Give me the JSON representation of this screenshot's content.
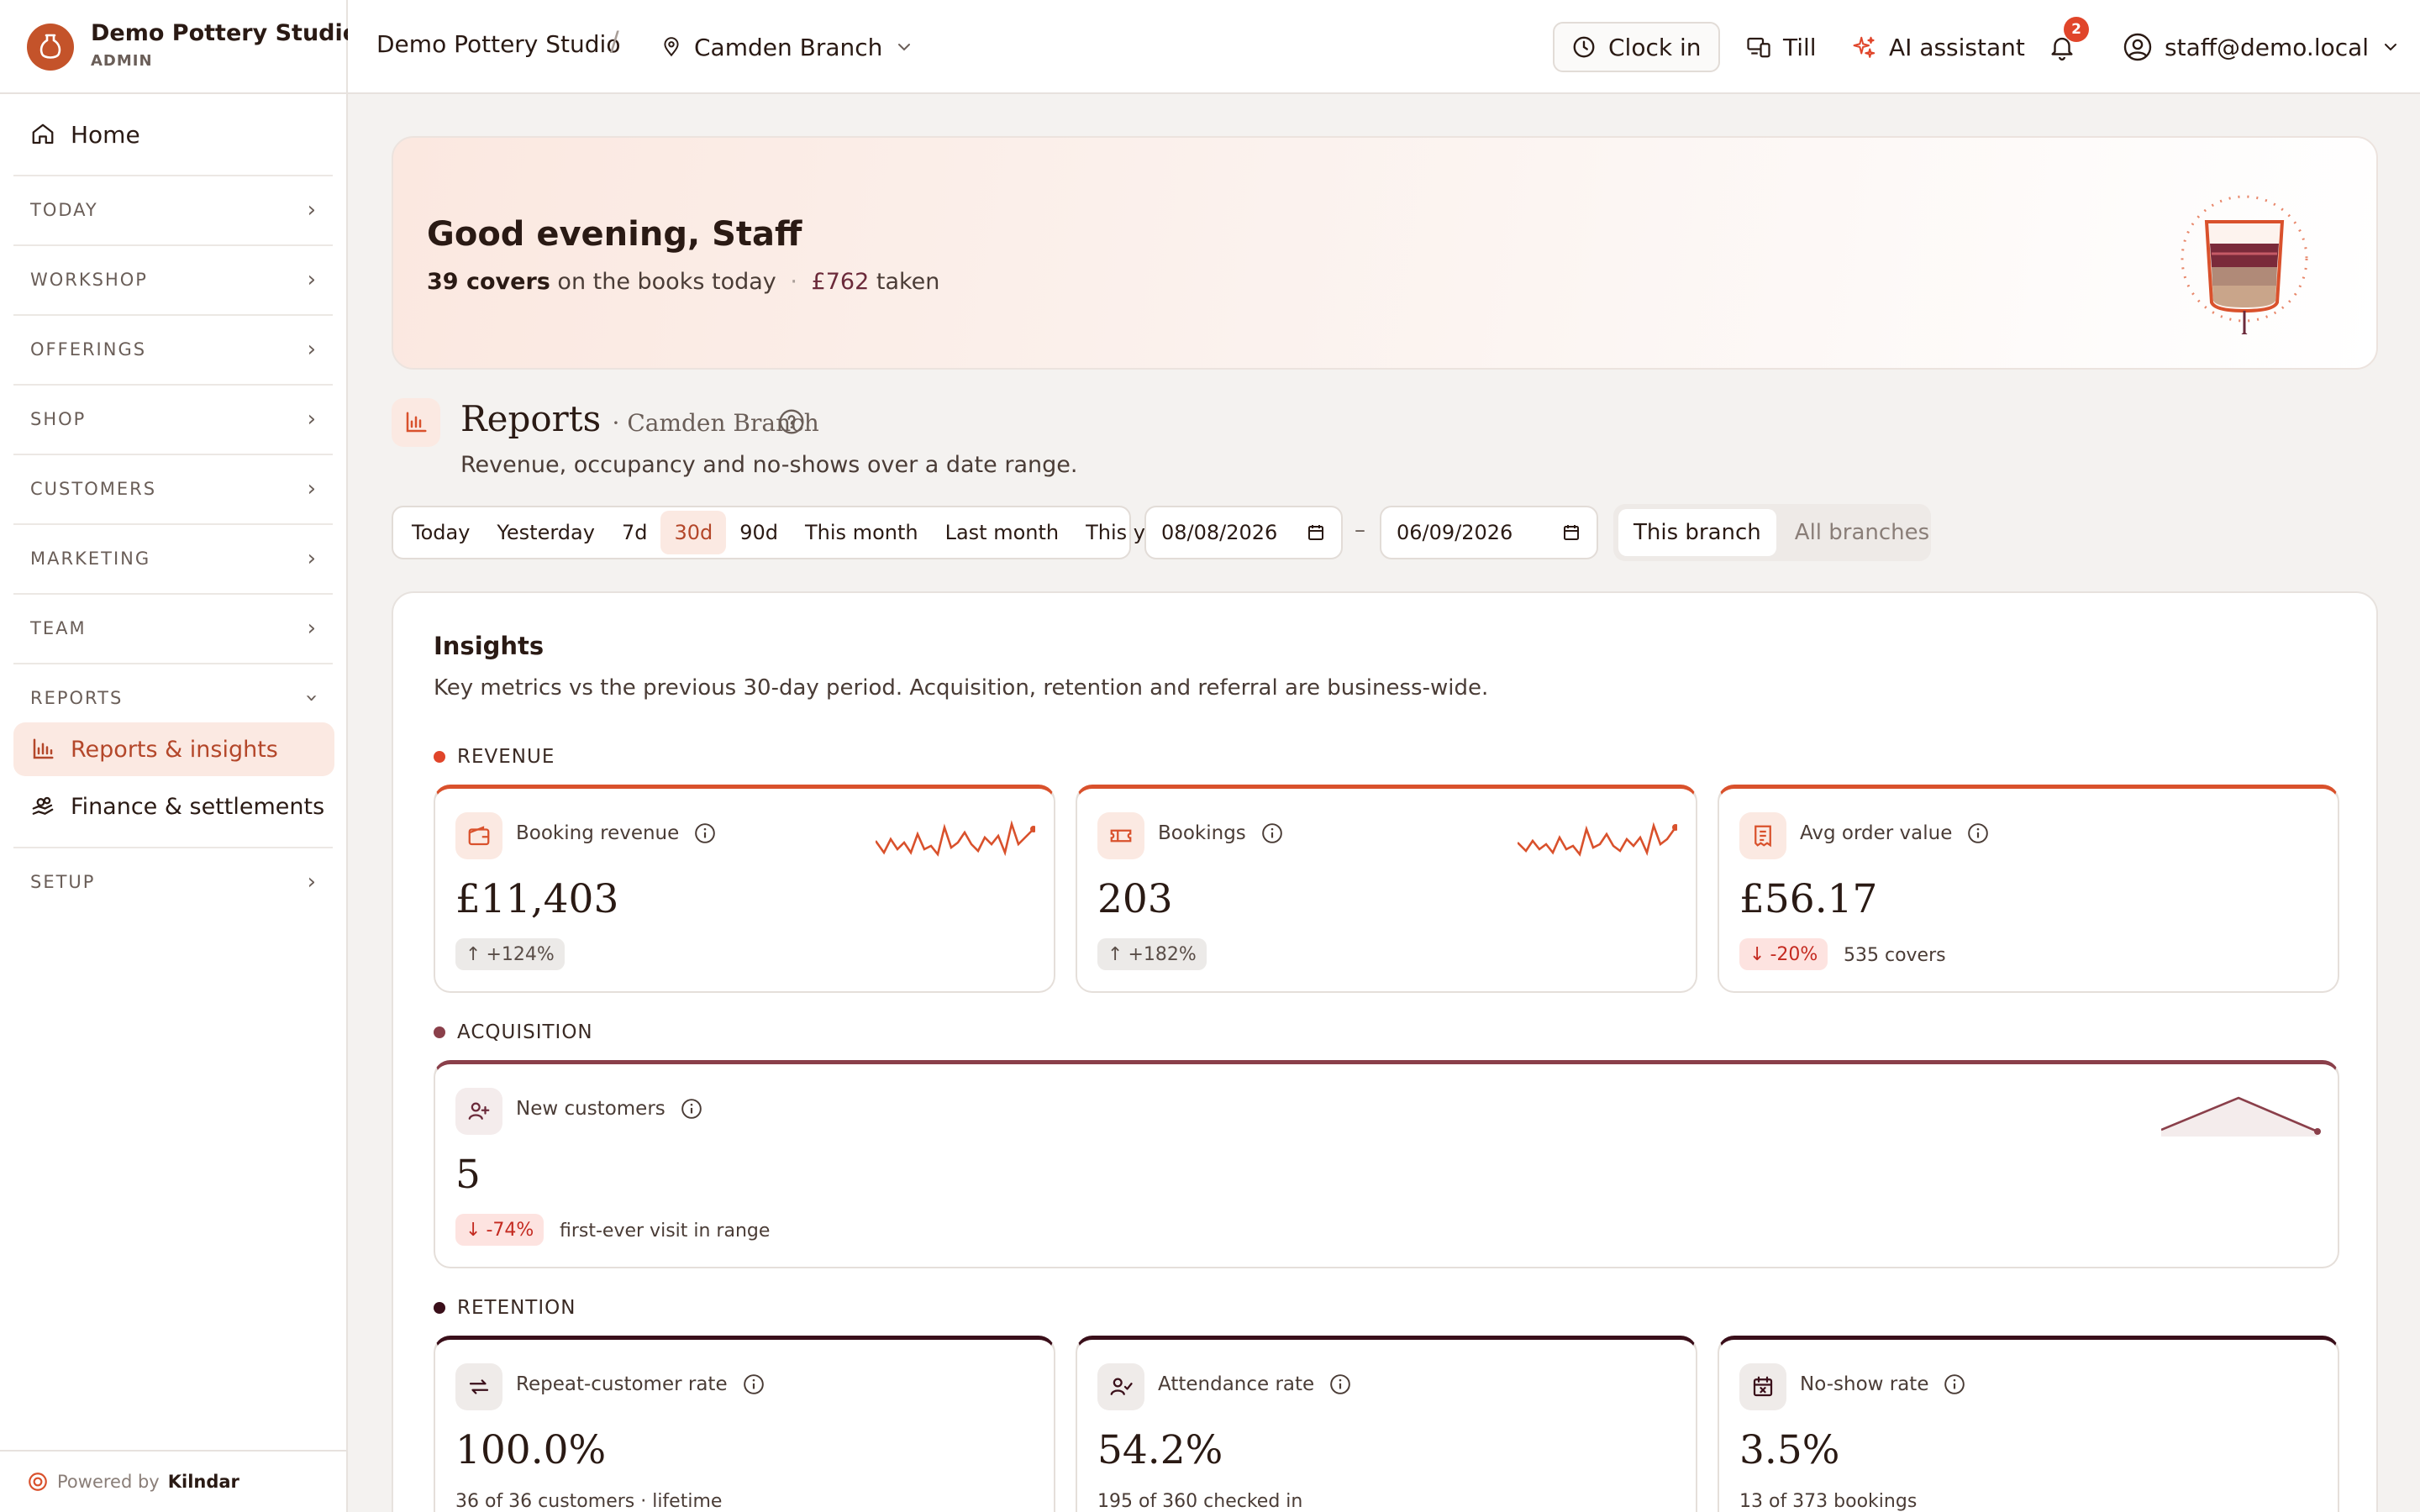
{
  "brand": {
    "name": "Demo Pottery Studio",
    "role": "ADMIN"
  },
  "sidebar": {
    "home": "Home",
    "sections": [
      {
        "label": "TODAY"
      },
      {
        "label": "WORKSHOP"
      },
      {
        "label": "OFFERINGS"
      },
      {
        "label": "SHOP"
      },
      {
        "label": "CUSTOMERS"
      },
      {
        "label": "MARKETING"
      },
      {
        "label": "TEAM"
      },
      {
        "label": "REPORTS"
      },
      {
        "label": "SETUP"
      }
    ],
    "reports_items": [
      {
        "label": "Reports & insights",
        "active": true
      },
      {
        "label": "Finance & settlements",
        "active": false
      }
    ],
    "powered_by_prefix": "Powered by",
    "powered_by_brand": "Kilndar"
  },
  "topbar": {
    "breadcrumb_studio": "Demo Pottery Studio",
    "breadcrumb_sep": "/",
    "branch": "Camden Branch",
    "clock_in": "Clock in",
    "till": "Till",
    "ai_assistant": "AI assistant",
    "notifications_count": "2",
    "user": "staff@demo.local"
  },
  "hero": {
    "greeting": "Good evening, Staff",
    "covers": "39 covers",
    "covers_suffix": "on the books today",
    "sep": "·",
    "taken_amount": "£762",
    "taken_suffix": "taken"
  },
  "reports": {
    "title": "Reports",
    "branch": "· Camden Branch",
    "description": "Revenue, occupancy and no-shows over a date range.",
    "ranges": [
      {
        "label": "Today",
        "active": false
      },
      {
        "label": "Yesterday",
        "active": false
      },
      {
        "label": "7d",
        "active": false
      },
      {
        "label": "30d",
        "active": true
      },
      {
        "label": "90d",
        "active": false
      },
      {
        "label": "This month",
        "active": false
      },
      {
        "label": "Last month",
        "active": false
      },
      {
        "label": "This year",
        "active": false
      }
    ],
    "date_from": "08/08/2026",
    "date_sep": "–",
    "date_to": "06/09/2026",
    "scope": [
      {
        "label": "This branch",
        "active": true
      },
      {
        "label": "All branches",
        "active": false
      }
    ]
  },
  "insights": {
    "title": "Insights",
    "description": "Key metrics vs the previous 30-day period. Acquisition, retention and referral are business-wide.",
    "sections": {
      "revenue": {
        "label": "REVENUE",
        "color": "#e0452a",
        "cards": [
          {
            "label": "Booking revenue",
            "icon": "wallet-icon",
            "value": "£11,403",
            "delta": "+124%",
            "direction": "up",
            "note": ""
          },
          {
            "label": "Bookings",
            "icon": "ticket-icon",
            "value": "203",
            "delta": "+182%",
            "direction": "up",
            "note": ""
          },
          {
            "label": "Avg order value",
            "icon": "receipt-icon",
            "value": "£56.17",
            "delta": "-20%",
            "direction": "down",
            "note": "535 covers"
          }
        ]
      },
      "acquisition": {
        "label": "ACQUISITION",
        "color": "#8a3f4a",
        "cards": [
          {
            "label": "New customers",
            "icon": "user-plus-icon",
            "value": "5",
            "delta": "-74%",
            "direction": "down",
            "note": "first-ever visit in range"
          }
        ]
      },
      "retention": {
        "label": "RETENTION",
        "color": "#3a0f1a",
        "cards": [
          {
            "label": "Repeat-customer rate",
            "icon": "repeat-icon",
            "value": "100.0%",
            "note": "36 of 36 customers · lifetime"
          },
          {
            "label": "Attendance rate",
            "icon": "user-check-icon",
            "value": "54.2%",
            "note": "195 of 360 checked in"
          },
          {
            "label": "No-show rate",
            "icon": "calendar-x-icon",
            "value": "3.5%",
            "note": "13 of 373 bookings"
          }
        ]
      }
    }
  },
  "colors": {
    "accent": "#d9512c",
    "accent_soft": "#fbe9e2",
    "acquisition": "#8a3f4a",
    "retention": "#3a0f1a",
    "delta_down": "#c42a20"
  }
}
